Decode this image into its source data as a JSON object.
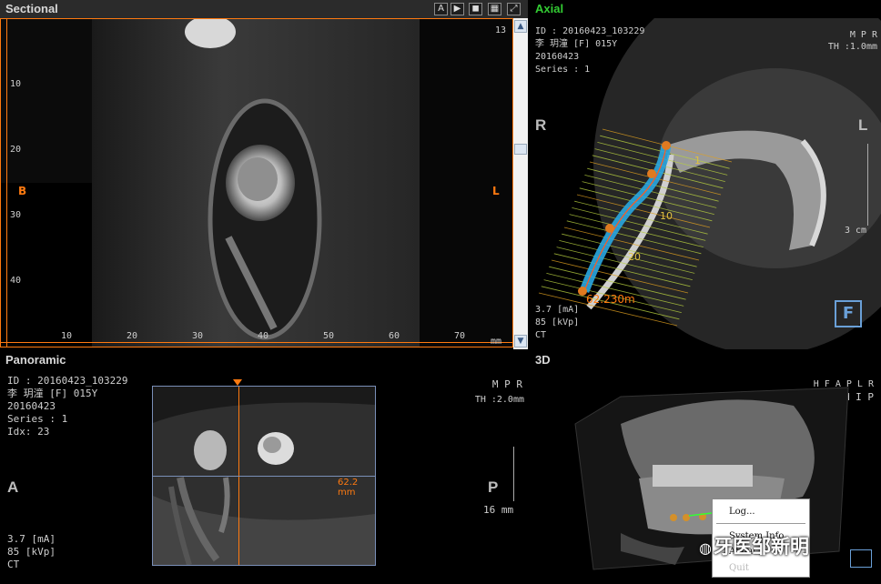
{
  "sectional": {
    "title": "Sectional",
    "slice_number": "13",
    "label_left": "B",
    "label_right": "L",
    "y_ticks": [
      "10",
      "20",
      "30",
      "40"
    ],
    "x_ticks": [
      "10",
      "20",
      "30",
      "40",
      "50",
      "60",
      "70"
    ],
    "x_unit": "mm",
    "toolbar": [
      "A",
      "▶",
      "◼",
      "▦",
      "⤢"
    ]
  },
  "axial": {
    "title": "Axial",
    "info": [
      "ID : 20160423_103229",
      "李 玥潼  [F] 015Y",
      "20160423",
      "Series : 1"
    ],
    "mode": "M P R",
    "thickness": "TH :1.0mm",
    "label_left": "R",
    "label_right": "L",
    "scale_label": "3 cm",
    "tech": [
      "3.7  [mA]",
      "85 [kVp]",
      "CT"
    ],
    "measurement": "62.230m",
    "curve_labels": [
      "1",
      "10",
      "20"
    ],
    "orientation_letter": "F"
  },
  "panoramic": {
    "title": "Panoramic",
    "info": [
      "ID : 20160423_103229",
      "李 玥潼  [F] 015Y",
      "20160423",
      "Series : 1",
      "Idx: 23"
    ],
    "mode": "M P R",
    "thickness": "TH :2.0mm",
    "label_left": "A",
    "label_right": "P",
    "depth": "16 mm",
    "tech": [
      "3.7  [mA]",
      "85 [kVp]",
      "CT"
    ],
    "measurement": "62.2 mm"
  },
  "view3d": {
    "title": "3D",
    "orientation": "H F A P L R",
    "mode": "M I P",
    "context_menu": [
      "Log...",
      "System Info",
      "About",
      "Quit"
    ],
    "watermark": "牙医邹新明"
  },
  "colors": {
    "accent_orange": "#ff7a10",
    "axial_title_green": "#33cc33",
    "curve_blue": "#2aa7e0",
    "scroll_bg": "#f2f2f2"
  }
}
